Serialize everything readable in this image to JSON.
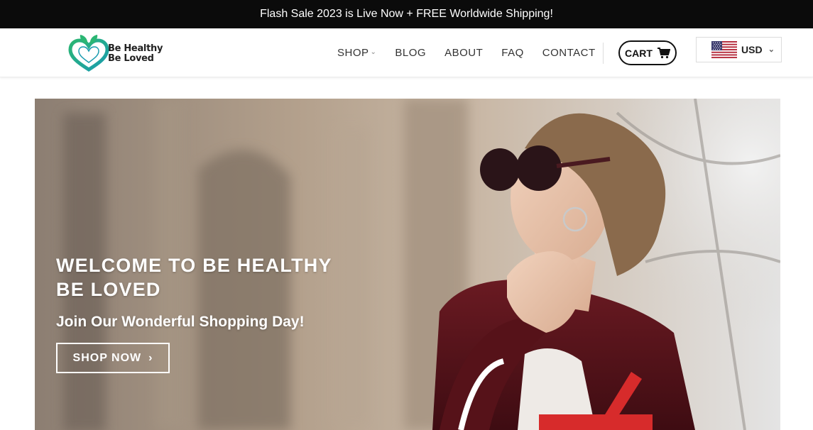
{
  "announcement": "Flash Sale 2023 is Live Now + FREE Worldwide Shipping!",
  "logo": {
    "line1": "Be Healthy",
    "line2": "Be Loved",
    "icon": "heart-leaf-icon",
    "colors": {
      "green": "#2bb673",
      "teal": "#1a9cb0"
    }
  },
  "nav": {
    "items": [
      "SHOP",
      "BLOG",
      "ABOUT",
      "FAQ",
      "CONTACT"
    ]
  },
  "cart": {
    "label": "CART",
    "icon": "cart-icon"
  },
  "currency": {
    "selected": "USD",
    "flag": "us-flag-icon"
  },
  "hero": {
    "title_line1": "WELCOME TO BE HEALTHY",
    "title_line2": "BE LOVED",
    "subtitle": "Join Our Wonderful Shopping Day!",
    "button_label": "SHOP NOW",
    "button_icon": "chevron-right-icon"
  },
  "colors": {
    "topbar": "#0b0b0b",
    "text": "#333333",
    "white": "#ffffff"
  }
}
